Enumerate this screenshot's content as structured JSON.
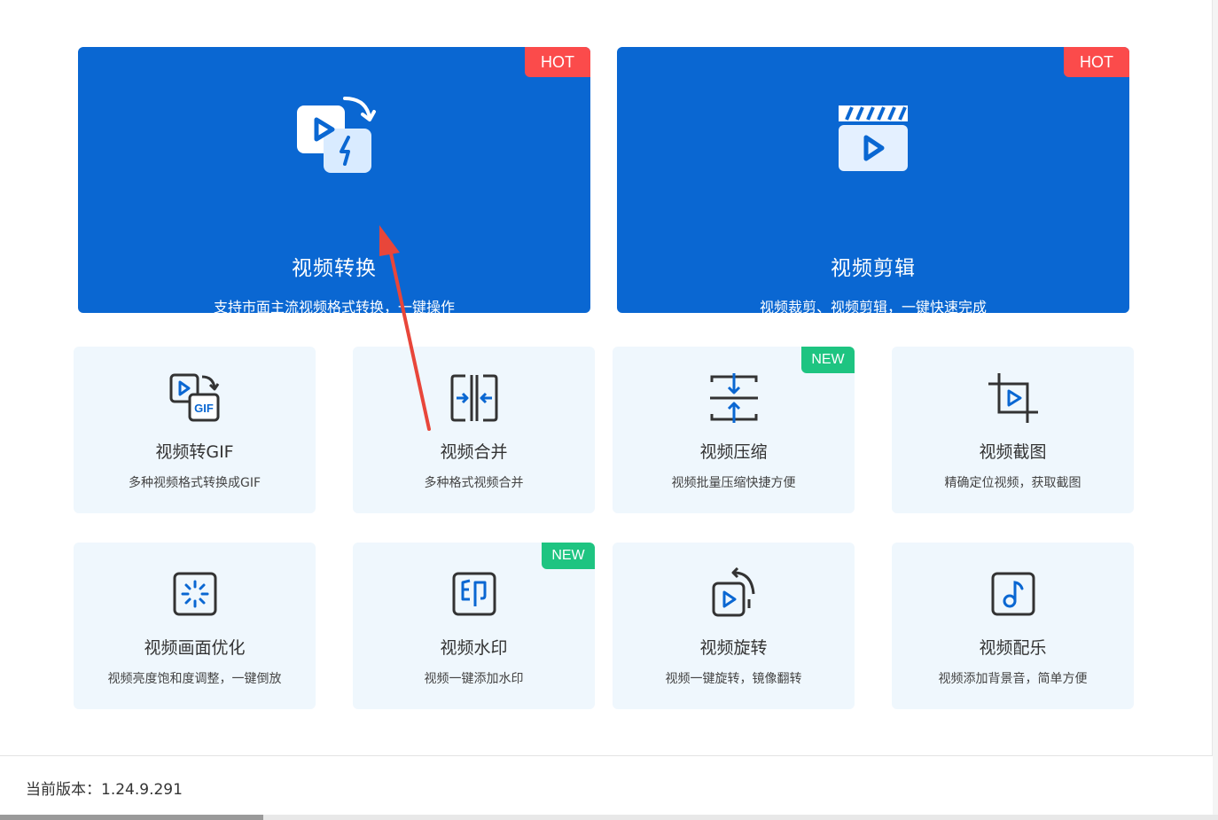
{
  "big_cards": [
    {
      "title": "视频转换",
      "desc": "支持市面主流视频格式转换，一键操作",
      "badge": "HOT",
      "icon": "video-convert-icon"
    },
    {
      "title": "视频剪辑",
      "desc": "视频裁剪、视频剪辑，一键快速完成",
      "badge": "HOT",
      "icon": "clapperboard-icon"
    }
  ],
  "cards": [
    {
      "title": "视频转GIF",
      "desc": "多种视频格式转换成GIF",
      "badge": "",
      "icon": "gif-convert-icon"
    },
    {
      "title": "视频合并",
      "desc": "多种格式视频合并",
      "badge": "",
      "icon": "merge-icon"
    },
    {
      "title": "视频压缩",
      "desc": "视频批量压缩快捷方便",
      "badge": "NEW",
      "icon": "compress-icon"
    },
    {
      "title": "视频截图",
      "desc": "精确定位视频，获取截图",
      "badge": "",
      "icon": "crop-icon"
    },
    {
      "title": "视频画面优化",
      "desc": "视频亮度饱和度调整，一键倒放",
      "badge": "",
      "icon": "enhance-icon"
    },
    {
      "title": "视频水印",
      "desc": "视频一键添加水印",
      "badge": "NEW",
      "icon": "watermark-icon"
    },
    {
      "title": "视频旋转",
      "desc": "视频一键旋转，镜像翻转",
      "badge": "",
      "icon": "rotate-icon"
    },
    {
      "title": "视频配乐",
      "desc": "视频添加背景音，简单方便",
      "badge": "",
      "icon": "music-icon"
    }
  ],
  "footer": {
    "version": "当前版本：1.24.9.291"
  },
  "colors": {
    "primary": "#0a67d2",
    "hot": "#fb4b4b",
    "new": "#1ec481",
    "card_bg": "#eff7fd",
    "annotation_arrow": "#e8463a"
  }
}
